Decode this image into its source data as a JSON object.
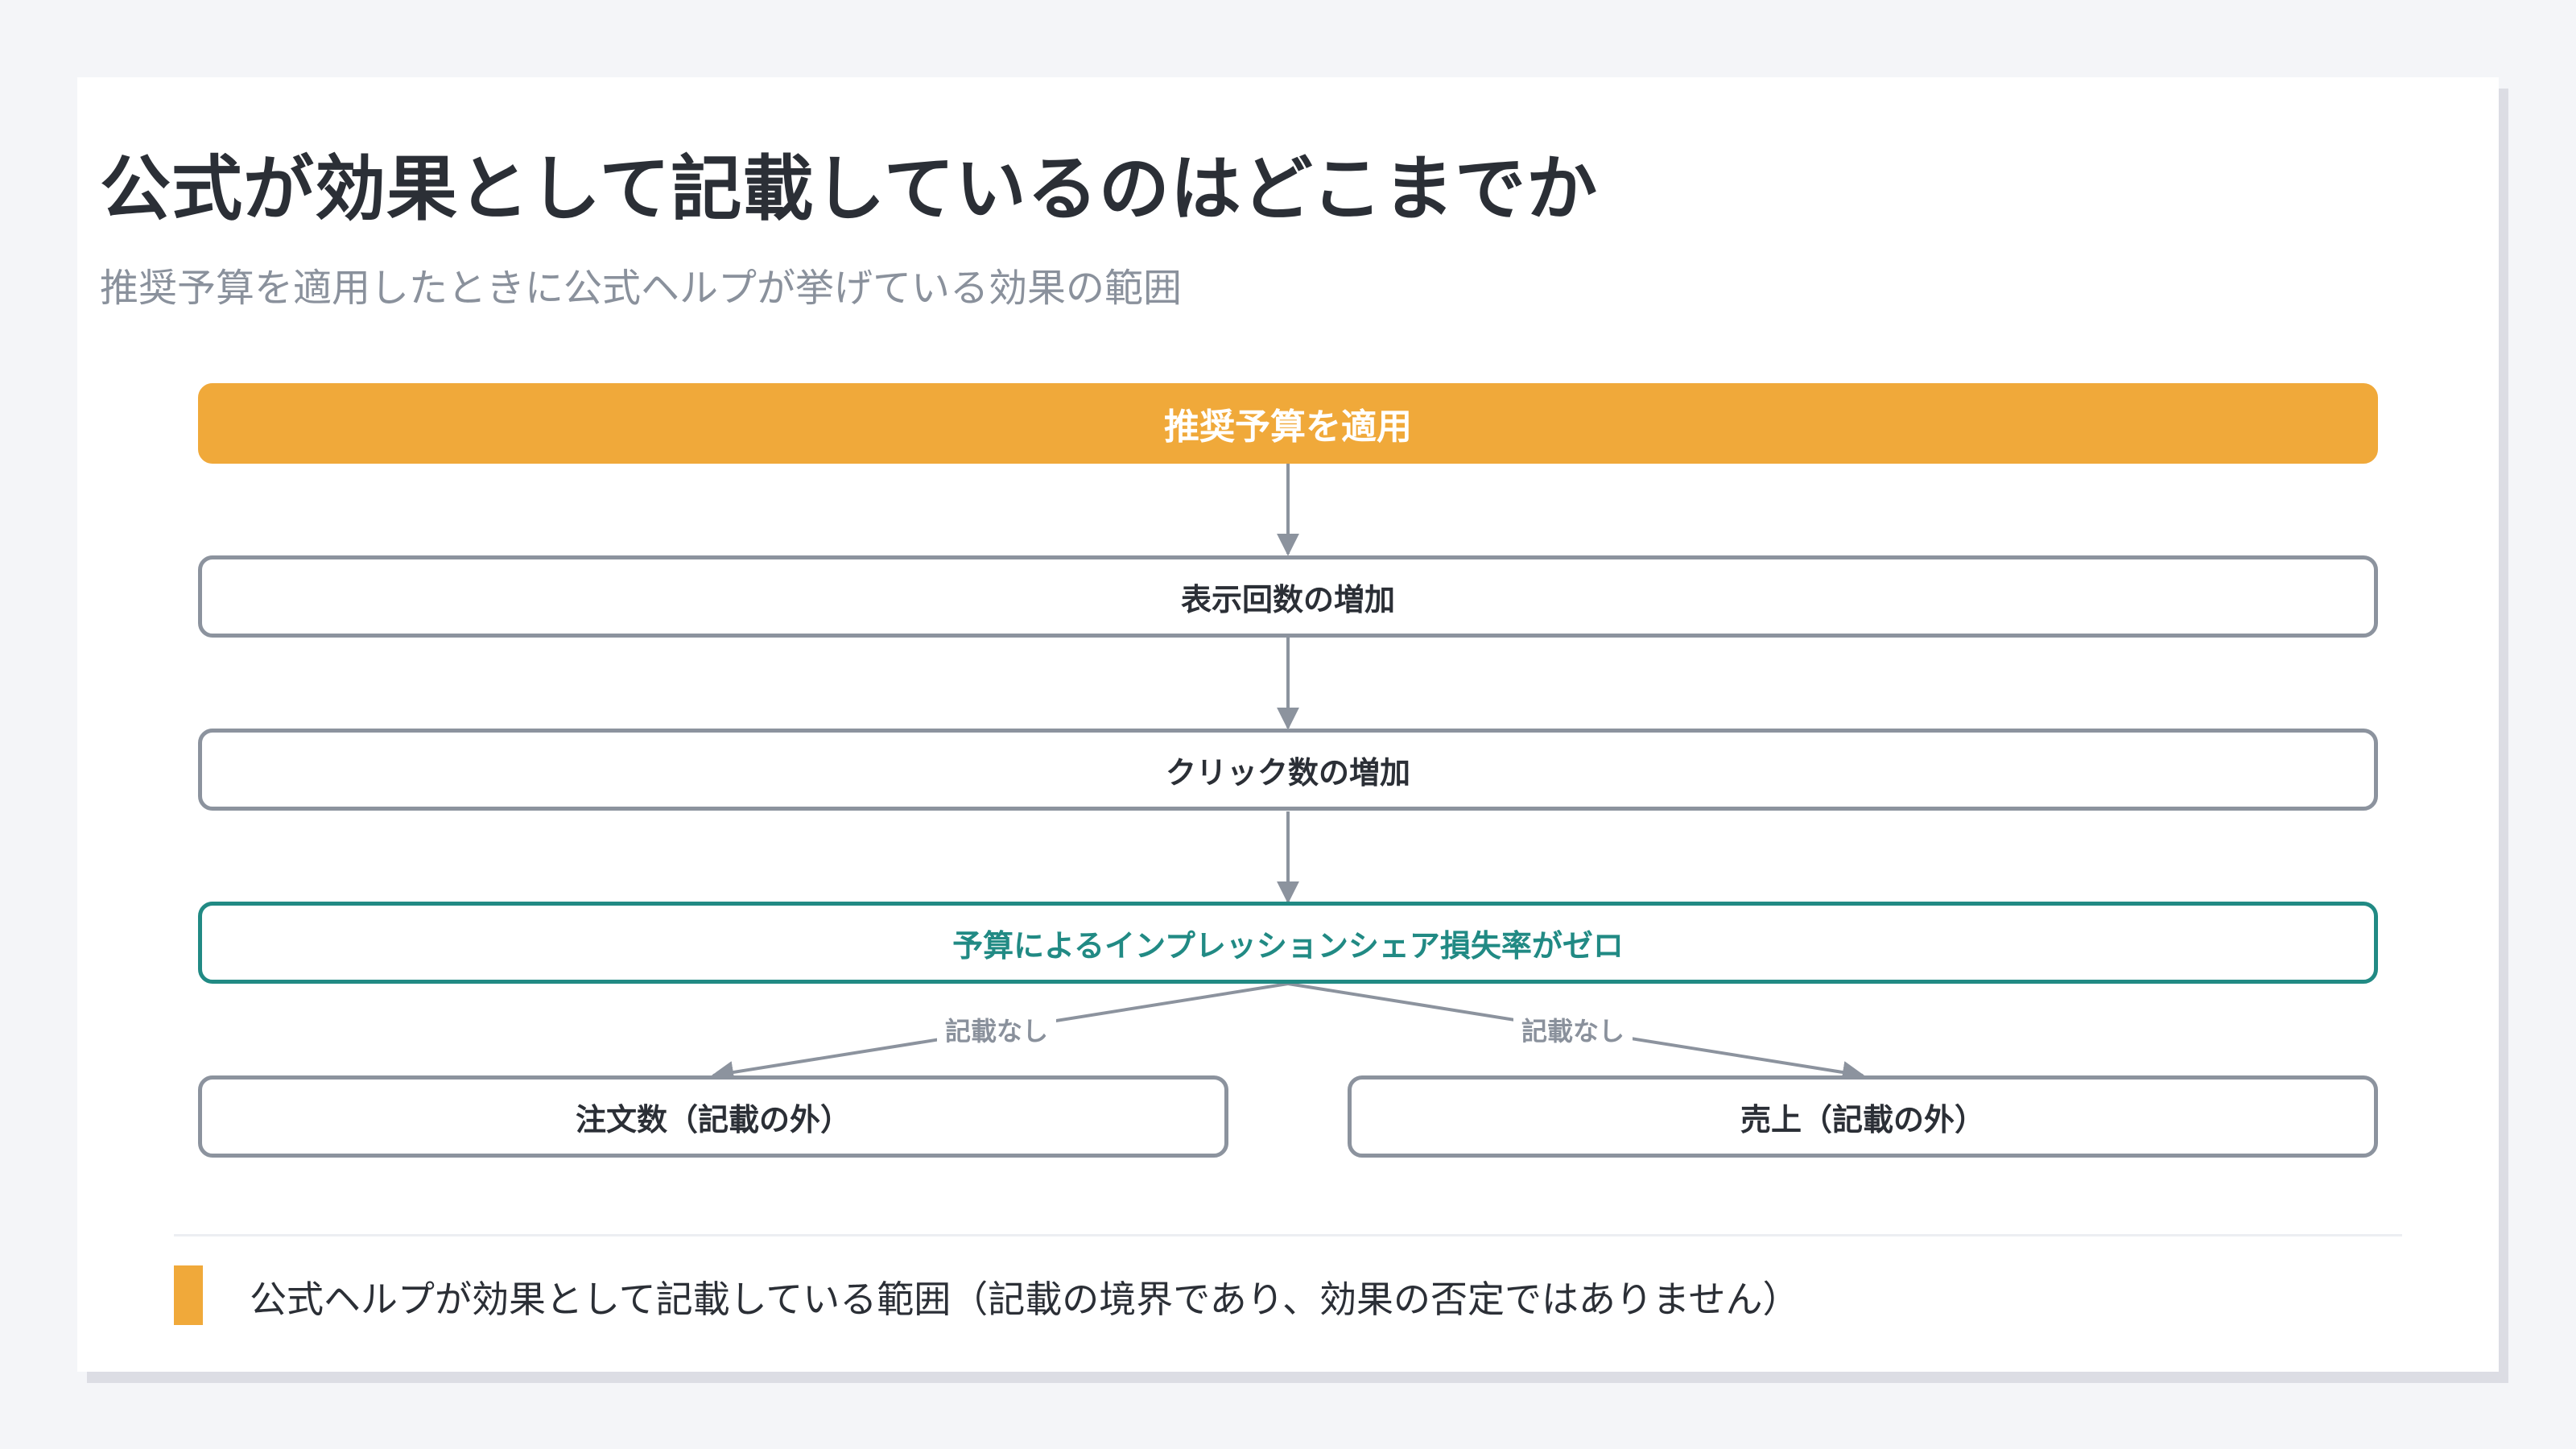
{
  "title": "公式が効果として記載しているのはどこまでか",
  "subtitle": "推奨予算を適用したときに公式ヘルプが挙げている効果の範囲",
  "diagram": {
    "nodes": [
      {
        "id": "apply",
        "label": "推奨予算を適用"
      },
      {
        "id": "impressions",
        "label": "表示回数の増加"
      },
      {
        "id": "clicks",
        "label": "クリック数の増加"
      },
      {
        "id": "is_lost",
        "label": "予算によるインプレッションシェア損失率がゼロ"
      },
      {
        "id": "orders",
        "label": "注文数（記載の外）"
      },
      {
        "id": "sales",
        "label": "売上（記載の外）"
      }
    ],
    "edge_labels": {
      "left": "記載なし",
      "right": "記載なし"
    }
  },
  "legend": {
    "text": "公式ヘルプが効果として記載している範囲（記載の境界であり、効果の否定ではありません）",
    "color": "#f0a93a"
  },
  "colors": {
    "accent": "#f0a93a",
    "key": "#218a84",
    "border": "#8c939e",
    "muted": "#8a919c"
  }
}
